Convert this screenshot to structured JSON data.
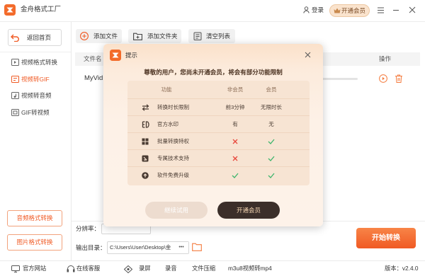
{
  "app": {
    "title": "金舟格式工厂",
    "icon": "app-logo-icon"
  },
  "titlebar": {
    "login": "登录",
    "vip": "开通会员"
  },
  "sidebar": {
    "back": "返回首页",
    "items": [
      {
        "label": "视频格式转换",
        "icon": "video-convert-icon",
        "active": false
      },
      {
        "label": "视频转GIF",
        "icon": "video-gif-icon",
        "active": true
      },
      {
        "label": "视频转音频",
        "icon": "video-audio-icon",
        "active": false
      },
      {
        "label": "GIF转视频",
        "icon": "gif-video-icon",
        "active": false
      }
    ],
    "bottom_buttons": [
      "音频格式转换",
      "图片格式转换"
    ]
  },
  "toolbar": {
    "add_file": "添加文件",
    "add_folder": "添加文件夹",
    "clear_list": "清空列表"
  },
  "file_table": {
    "col_name": "文件名",
    "col_actions": "操作",
    "rows": [
      {
        "name": "MyVid",
        "actions": [
          "play-icon",
          "trash-icon"
        ]
      }
    ]
  },
  "settings": {
    "resolution_label": "分辨率：",
    "output_label": "输出目录：",
    "output_path": "C:\\Users\\User\\Desktop\\金",
    "browse": "•••"
  },
  "start_button": "开始转换",
  "footer": {
    "links": [
      {
        "label": "官方网站",
        "icon": "website-icon"
      },
      {
        "label": "在线客服",
        "icon": "support-icon"
      },
      {
        "label": "录屏",
        "icon": "screen-record-icon"
      },
      {
        "label": "录音"
      },
      {
        "label": "文件压缩"
      },
      {
        "label": "m3u8视频转mp4"
      }
    ],
    "version": "版本：v2.4.0"
  },
  "dialog": {
    "title": "提示",
    "message": "尊敬的用户，您尚未开通会员，将会有部分功能限制",
    "columns": {
      "feature": "功能",
      "free": "非会员",
      "vip": "会员"
    },
    "rows": [
      {
        "icon": "swap-icon",
        "feature": "转换时长限制",
        "free": "前3分钟",
        "vip": "无限时长"
      },
      {
        "icon": "watermark-icon",
        "feature": "官方水印",
        "free": "有",
        "vip": "无"
      },
      {
        "icon": "batch-icon",
        "feature": "批量转换特权",
        "free_icon": "cross-icon",
        "vip_icon": "check-icon"
      },
      {
        "icon": "tech-support-icon",
        "feature": "专属技术支持",
        "free_icon": "cross-icon",
        "vip_icon": "check-icon"
      },
      {
        "icon": "upgrade-icon",
        "feature": "软件免费升级",
        "free_icon": "check-icon",
        "vip_icon": "check-icon"
      }
    ],
    "buttons": {
      "trial": "继续试用",
      "upgrade": "开通会员"
    }
  },
  "colors": {
    "accent": "#f05a24",
    "dialog_bg": "#fcefe4",
    "vip_button": "#3b2f2a",
    "check": "#3db56c",
    "cross": "#e8473c"
  }
}
